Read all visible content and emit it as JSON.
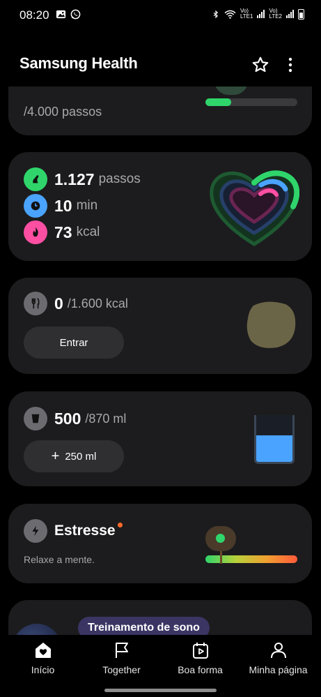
{
  "status_bar": {
    "time": "08:20",
    "sim1_top": "Vo)",
    "sim1_bottom": "LTE1",
    "sim2_top": "Vo)",
    "sim2_bottom": "LTE2",
    "icons": [
      "gallery-icon",
      "whatsapp-icon",
      "bluetooth-icon",
      "wifi-icon",
      "signal-icon",
      "battery-icon"
    ]
  },
  "header": {
    "title": "Samsung Health",
    "icons": [
      "star-icon",
      "more-vertical-icon"
    ]
  },
  "steps_card_partial": {
    "goal_text": "/4.000 passos",
    "progress": 0.28,
    "bar_color": "#2fd56b"
  },
  "activity_card": {
    "steps_value": "1.127",
    "steps_unit": "passos",
    "minutes_value": "10",
    "minutes_unit": "min",
    "kcal_value": "73",
    "kcal_unit": "kcal",
    "colors": {
      "steps": "#2fd56b",
      "minutes": "#4aa3ff",
      "kcal": "#ff4fa3"
    }
  },
  "food_card": {
    "value": "0",
    "goal": "/1.600 kcal",
    "button_label": "Entrar"
  },
  "water_card": {
    "value": "500",
    "goal": "/870 ml",
    "button_label": "250 ml",
    "fill_level": 0.57,
    "water_color": "#4aa3ff"
  },
  "stress_card": {
    "title": "Estresse",
    "subtitle": "Relaxe a mente.",
    "indicator_level": 0.17
  },
  "sleep_card_partial": {
    "badge": "Treinamento de sono"
  },
  "bottom_nav": {
    "items": [
      {
        "label": "Início",
        "icon": "home-heart-icon"
      },
      {
        "label": "Together",
        "icon": "flag-icon"
      },
      {
        "label": "Boa forma",
        "icon": "calendar-play-icon"
      },
      {
        "label": "Minha página",
        "icon": "person-icon"
      }
    ]
  }
}
